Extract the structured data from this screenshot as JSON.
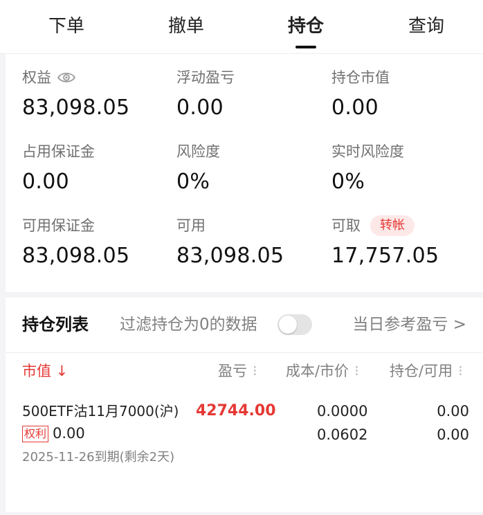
{
  "tabs": [
    {
      "label": "下单"
    },
    {
      "label": "撤单"
    },
    {
      "label": "持仓",
      "active": true
    },
    {
      "label": "查询"
    }
  ],
  "summary": {
    "equity": {
      "label": "权益",
      "value": "83,098.05",
      "icon": "eye-icon"
    },
    "floating_pnl": {
      "label": "浮动盈亏",
      "value": "0.00"
    },
    "position_value": {
      "label": "持仓市值",
      "value": "0.00"
    },
    "used_margin": {
      "label": "占用保证金",
      "value": "0.00"
    },
    "risk": {
      "label": "风险度",
      "value": "0%"
    },
    "realtime_risk": {
      "label": "实时风险度",
      "value": "0%"
    },
    "available_margin": {
      "label": "可用保证金",
      "value": "83,098.05"
    },
    "available": {
      "label": "可用",
      "value": "83,098.05"
    },
    "withdrawable": {
      "label": "可取",
      "value": "17,757.05",
      "transfer_label": "转帐"
    }
  },
  "holdings": {
    "title": "持仓列表",
    "filter_label": "过滤持仓为0的数据",
    "filter_on": false,
    "daily_link": "当日参考盈亏 >",
    "columns": {
      "market_value": "市值 ↓",
      "pnl": "盈亏",
      "cost_price": "成本/市价",
      "position_available": "持仓/可用",
      "menu_glyph": "⁝"
    },
    "rows": [
      {
        "name": "500ETF沽11月7000(沪)",
        "pnl": "42744.00",
        "badge": "权利",
        "market_value": "0.00",
        "cost": "0.0000",
        "price": "0.0602",
        "position": "0.00",
        "available": "0.00",
        "expiry": "2025-11-26到期(剩余2天)"
      }
    ]
  },
  "colors": {
    "accent_red": "#e53935",
    "badge_bg": "#fde8e8",
    "label_gray": "#707070",
    "background": "#f4f4f6"
  }
}
